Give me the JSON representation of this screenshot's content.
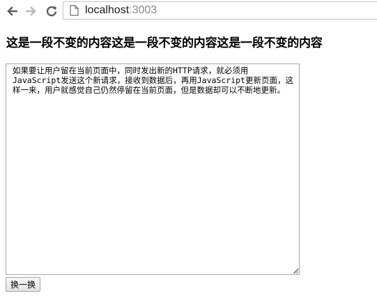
{
  "browser": {
    "url_host": "localhost",
    "url_port": ":3003",
    "icons": {
      "back": "back-arrow-icon",
      "forward": "forward-arrow-icon",
      "reload": "reload-icon",
      "page": "page-icon"
    }
  },
  "page": {
    "heading": "这是一段不变的内容这是一段不变的内容这是一段不变的内容",
    "textarea_value": "如果要让用户留在当前页面中，同时发出新的HTTP请求，就必须用JavaScript发送这个新请求，接收到数据后，再用JavaScript更新页面，这样一来，用户就感觉自己仍然停留在当前页面，但是数据却可以不断地更新。",
    "button_label": "换一换"
  },
  "colors": {
    "nav_active": "#5f5f5f",
    "nav_disabled": "#b8b8b8",
    "url_port": "#8a8a8a",
    "address_border": "#c3c3c3"
  }
}
